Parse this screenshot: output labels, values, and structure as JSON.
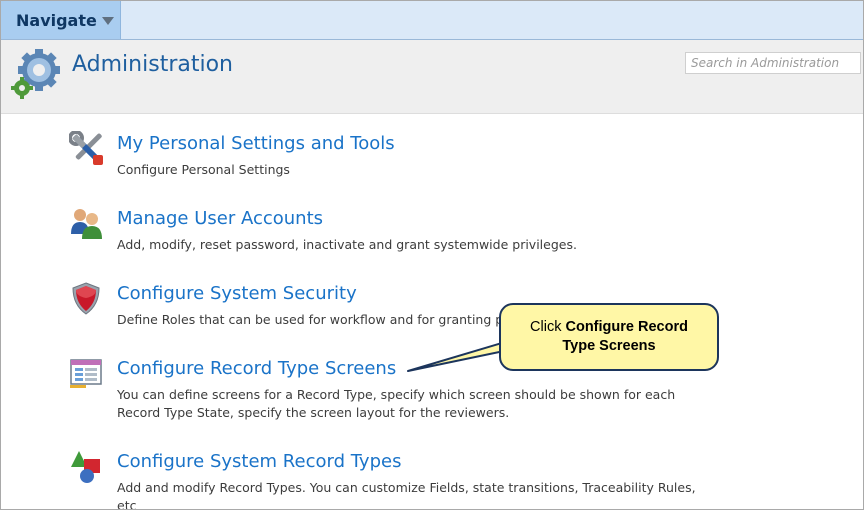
{
  "nav": {
    "label": "Navigate"
  },
  "header": {
    "title": "Administration",
    "search_placeholder": "Search in Administration"
  },
  "items": [
    {
      "icon": "tools-icon",
      "title": "My Personal Settings and Tools",
      "description": "Configure Personal Settings"
    },
    {
      "icon": "users-icon",
      "title": "Manage User Accounts",
      "description": "Add, modify, reset password, inactivate and grant systemwide privileges."
    },
    {
      "icon": "shield-icon",
      "title": "Configure System Security",
      "description": "Define Roles that can be used for workflow and for granting per"
    },
    {
      "icon": "screen-layout-icon",
      "title": "Configure Record Type Screens",
      "description": "You can define screens for a Record Type, specify which screen should be shown for each Record Type State, specify the screen layout for the reviewers."
    },
    {
      "icon": "shapes-icon",
      "title": "Configure System Record Types",
      "description": "Add and modify Record Types. You can customize Fields, state transitions, Traceability Rules, etc"
    }
  ],
  "callout": {
    "prefix": "Click ",
    "bold": "Configure Record Type Screens"
  },
  "colors": {
    "link": "#1a73c8",
    "title": "#1f5f9f",
    "nav_bg": "#a9cdf0",
    "callout_bg": "#fff7a6"
  }
}
